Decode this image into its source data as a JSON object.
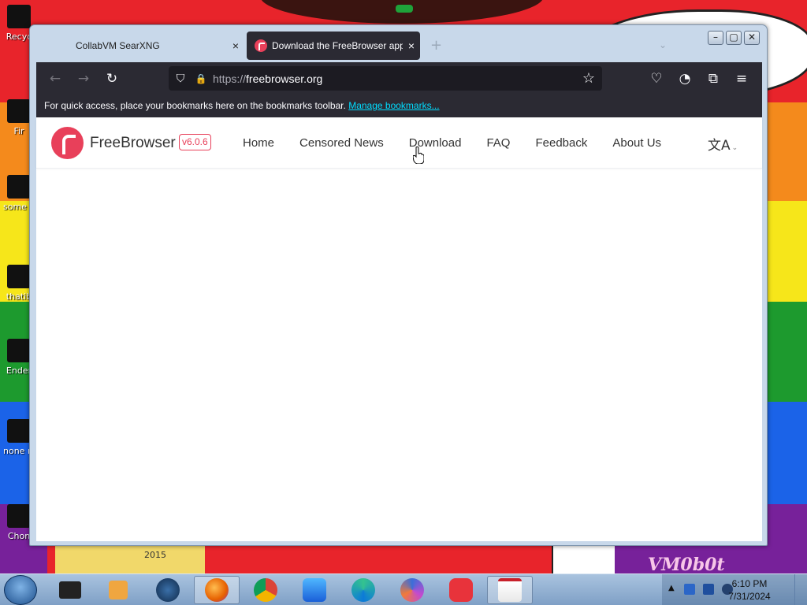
{
  "desktop": {
    "icons": [
      {
        "label": "Recyc"
      },
      {
        "label": "Fir"
      },
      {
        "label": "some ran"
      },
      {
        "label": "thatib"
      },
      {
        "label": "Ender"
      },
      {
        "label": "none retard"
      },
      {
        "label": "Chon"
      }
    ],
    "wallpaper_text": {
      "year": "2015",
      "watermark": "VM0b0t"
    },
    "pride_colors": [
      "#e8242b",
      "#f48a1c",
      "#f6e61a",
      "#1d9a2e",
      "#1b63e8",
      "#77219a"
    ]
  },
  "browser": {
    "tabs": [
      {
        "title": "CollabVM SearXNG",
        "active": false,
        "close_glyph": "×"
      },
      {
        "title": "Download the FreeBrowser app",
        "active": true,
        "close_glyph": "×"
      }
    ],
    "new_tab_glyph": "+",
    "list_tabs_glyph": "⌄",
    "window_controls": {
      "minimize": "–",
      "maximize": "▢",
      "close": "✕"
    },
    "nav": {
      "back": "←",
      "forward": "→",
      "reload": "↻"
    },
    "url": {
      "protocol": "https://",
      "host": "freebrowser.org"
    },
    "url_icons": {
      "shield": "⛉",
      "lock": "🔒",
      "bookmark_star": "☆"
    },
    "toolbar_icons": [
      "pocket-icon",
      "account-icon",
      "extensions-icon",
      "menu-icon"
    ],
    "toolbar_glyphs": {
      "pocket": "♡",
      "account": "◔",
      "extensions": "⧉",
      "menu": "≡"
    },
    "bookmarks_bar": {
      "message": "For quick access, place your bookmarks here on the bookmarks toolbar.",
      "link": "Manage bookmarks..."
    }
  },
  "site": {
    "brand": "FreeBrowser",
    "version": "v6.0.6",
    "brand_color": "#e8405a",
    "menu": [
      "Home",
      "Censored News",
      "Download",
      "FAQ",
      "Feedback",
      "About Us"
    ],
    "language_glyph": "文A",
    "language_caret": "⌄"
  },
  "taskbar": {
    "apps": [
      {
        "name": "terminal"
      },
      {
        "name": "media-player"
      },
      {
        "name": "globe"
      },
      {
        "name": "firefox",
        "active": true
      },
      {
        "name": "chrome"
      },
      {
        "name": "waterfox"
      },
      {
        "name": "edge"
      },
      {
        "name": "thorium"
      },
      {
        "name": "vivaldi"
      },
      {
        "name": "freebrowser",
        "active": true
      }
    ],
    "clock": {
      "time": "6:10 PM",
      "date": "7/31/2024"
    },
    "tray_arrow": "▲"
  }
}
